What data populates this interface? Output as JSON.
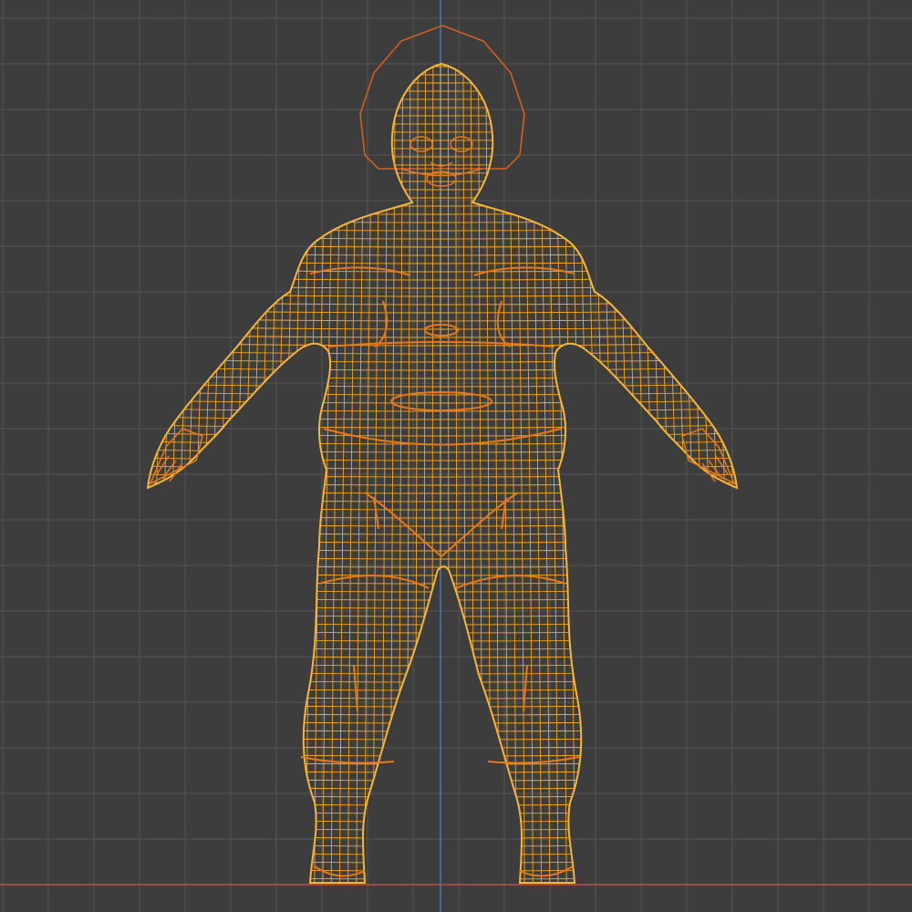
{
  "viewport": {
    "view": "front-orthographic",
    "shading": "wireframe",
    "background_color": "#3d3d3d",
    "grid_color": "#555555",
    "axis_x_color": "#c44a4a",
    "axis_z_color": "#4a7bb0",
    "wire_color": "#f5a623",
    "wire_highlight_color": "#e8791a",
    "selected_object": "character-mesh"
  },
  "object": {
    "type": "humanoid-character-mesh",
    "pose": "A-pose",
    "selected": true,
    "has_envelope_outline": true
  }
}
